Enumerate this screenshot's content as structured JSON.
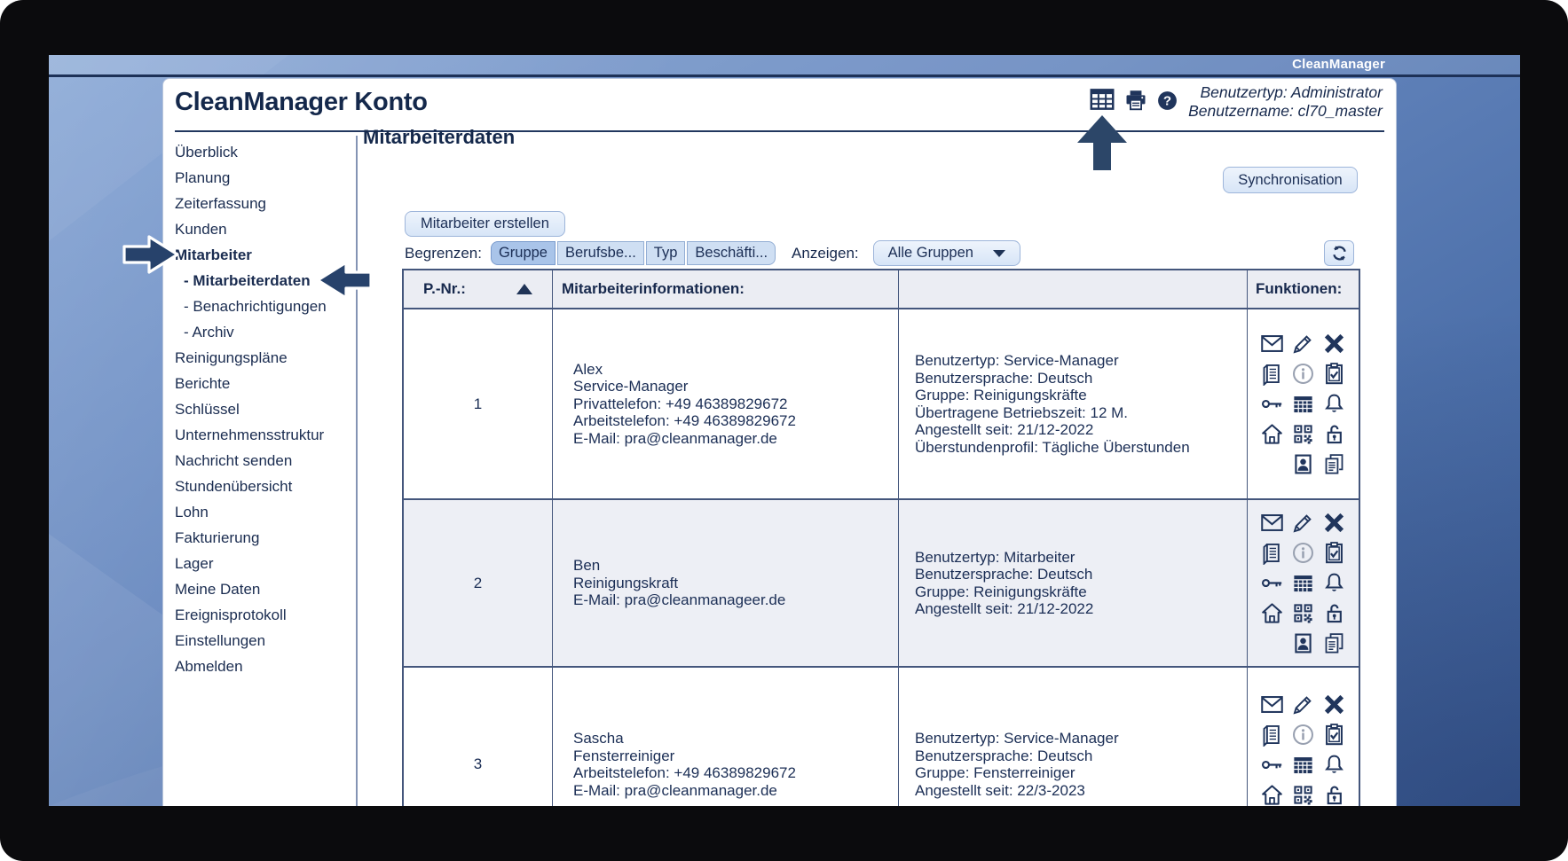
{
  "window": {
    "brand": "CleanManager"
  },
  "header": {
    "title": "CleanManager Konto",
    "user_type_label": "Benutzertyp: Administrator",
    "user_name_label": "Benutzername: cl70_master",
    "toolbar_icons": [
      "table-view-icon",
      "print-icon",
      "help-icon"
    ]
  },
  "sidebar": {
    "items": [
      {
        "label": "Überblick"
      },
      {
        "label": "Planung"
      },
      {
        "label": "Zeiterfassung"
      },
      {
        "label": "Kunden"
      },
      {
        "label": "Mitarbeiter",
        "bold": true
      },
      {
        "label": "- Mitarbeiterdaten",
        "bold": true,
        "indent": true
      },
      {
        "label": "- Benachrichtigungen",
        "indent": true
      },
      {
        "label": "- Archiv",
        "indent": true
      },
      {
        "label": "Reinigungspläne"
      },
      {
        "label": "Berichte"
      },
      {
        "label": "Schlüssel"
      },
      {
        "label": "Unternehmensstruktur"
      },
      {
        "label": "Nachricht senden"
      },
      {
        "label": "Stundenübersicht"
      },
      {
        "label": "Lohn"
      },
      {
        "label": "Fakturierung"
      },
      {
        "label": "Lager"
      },
      {
        "label": "Meine Daten"
      },
      {
        "label": "Ereignisprotokoll"
      },
      {
        "label": "Einstellungen"
      },
      {
        "label": "Abmelden"
      }
    ]
  },
  "main": {
    "page_title": "Mitarbeiterdaten",
    "sync_button": "Synchronisation",
    "create_button": "Mitarbeiter erstellen",
    "filter": {
      "limit_label": "Begrenzen:",
      "segments": [
        {
          "label": "Gruppe",
          "selected": true
        },
        {
          "label": "Berufsbe...",
          "selected": false
        },
        {
          "label": "Typ",
          "selected": false
        },
        {
          "label": "Beschäfti...",
          "selected": false
        }
      ],
      "show_label": "Anzeigen:",
      "group_select": "Alle Gruppen"
    },
    "table": {
      "headers": [
        "P.-Nr.:",
        "Mitarbeiterinformationen:",
        "",
        "Funktionen:"
      ],
      "sort_column": "P.-Nr.:",
      "sort_direction": "ascending",
      "function_icon_rows": [
        [
          "envelope-icon",
          "pencil-icon",
          "delete-icon"
        ],
        [
          "ledger-icon",
          "info-icon",
          "clipboard-check-icon"
        ],
        [
          "key-icon",
          "calendar-icon",
          "bell-icon"
        ],
        [
          "house-icon",
          "qr-code-icon",
          "unlock-icon"
        ],
        [
          "",
          "id-badge-icon",
          "documents-icon"
        ]
      ],
      "rows": [
        {
          "pnr": "1",
          "shaded": false,
          "info_lines": [
            "Alex",
            "Service-Manager",
            "Privattelefon: +49 46389829672",
            "Arbeitstelefon: +49 46389829672",
            "E-Mail: pra@cleanmanager.de"
          ],
          "detail_lines": [
            "Benutzertyp: Service-Manager",
            "Benutzersprache: Deutsch",
            "Gruppe: Reinigungskräfte",
            "Übertragene Betriebszeit: 12 M.",
            "Angestellt seit: 21/12-2022",
            "Überstundenprofil: Tägliche Überstunden"
          ]
        },
        {
          "pnr": "2",
          "shaded": true,
          "info_lines": [
            "Ben",
            "Reinigungskraft",
            "E-Mail: pra@cleanmanageer.de"
          ],
          "detail_lines": [
            "Benutzertyp: Mitarbeiter",
            "Benutzersprache: Deutsch",
            "Gruppe: Reinigungskräfte",
            "Angestellt seit: 21/12-2022"
          ]
        },
        {
          "pnr": "3",
          "shaded": false,
          "info_lines": [
            "Sascha",
            "Fensterreiniger",
            "Arbeitstelefon: +49 46389829672",
            "E-Mail: pra@cleanmanager.de"
          ],
          "detail_lines": [
            "Benutzertyp: Service-Manager",
            "Benutzersprache: Deutsch",
            "Gruppe: Fensterreiniger",
            "Angestellt seit: 22/3-2023"
          ]
        }
      ]
    }
  },
  "colors": {
    "accent_navy": "#17294d",
    "panel_white": "#ffffff",
    "selected_segment": "#a9c4e9",
    "button_blue": "#d7e5f7",
    "background_blue": "#5d80b8",
    "table_border": "#44567c",
    "shaded_row": "#edeff5"
  }
}
